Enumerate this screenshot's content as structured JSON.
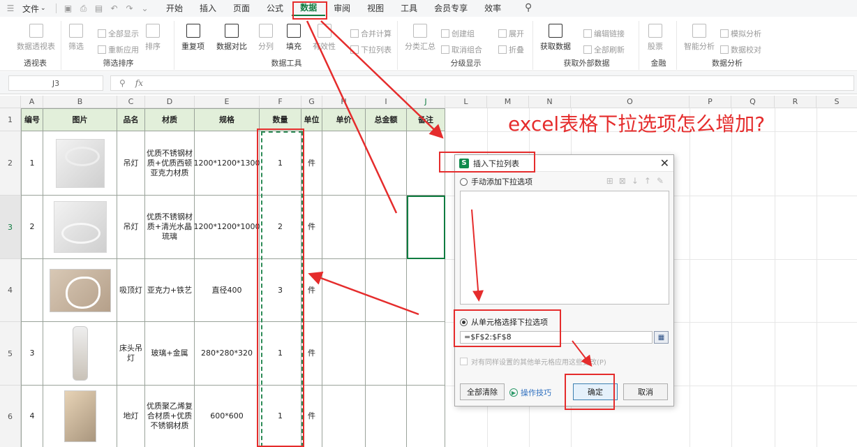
{
  "menubar": {
    "file": "文件",
    "tabs": [
      "开始",
      "插入",
      "页面",
      "公式",
      "数据",
      "审阅",
      "视图",
      "工具",
      "会员专享",
      "效率"
    ],
    "active_tab": "数据"
  },
  "ribbon": {
    "groups": {
      "pivot": "透视表",
      "filter_sort": "筛选排序",
      "data_tools": "数据工具",
      "outline": "分级显示",
      "external": "获取外部数据",
      "stocks": "金融",
      "analysis": "数据分析"
    },
    "buttons": {
      "pivot_table": "数据透视表",
      "filter": "筛选",
      "show_all": "全部显示",
      "reapply": "重新应用",
      "sort": "排序",
      "duplicates": "重复项",
      "compare": "数据对比",
      "split": "分列",
      "fill": "填充",
      "validation": "有效性",
      "merge_calc": "合并计算",
      "dropdown_list": "下拉列表",
      "subtotal": "分类汇总",
      "group": "创建组",
      "ungroup": "取消组合",
      "expand": "展开",
      "collapse": "折叠",
      "get_data": "获取数据",
      "edit_links": "编辑链接",
      "refresh_all": "全部刷新",
      "stocks": "股票",
      "smart_analysis": "智能分析",
      "simulate": "模拟分析",
      "verify": "数据校对"
    }
  },
  "formula_bar": {
    "name_box": "J3",
    "fx": "fx",
    "formula": ""
  },
  "columns": [
    "A",
    "B",
    "C",
    "D",
    "E",
    "F",
    "G",
    "H",
    "I",
    "J",
    "L",
    "M",
    "N",
    "O",
    "P",
    "Q",
    "R",
    "S"
  ],
  "rows": [
    "1",
    "2",
    "3",
    "4",
    "5",
    "6"
  ],
  "table": {
    "headers": [
      "编号",
      "图片",
      "品名",
      "材质",
      "规格",
      "数量",
      "单位",
      "单价",
      "总金额",
      "备注"
    ],
    "rows": [
      {
        "no": "1",
        "name": "吊灯",
        "material": "优质不锈钢材质+优质西顿亚克力材质",
        "spec": "1200*1200*1300",
        "qty": "1",
        "unit": "件"
      },
      {
        "no": "2",
        "name": "吊灯",
        "material": "优质不锈钢材质+清光水晶琉璃",
        "spec": "1200*1200*1000",
        "qty": "2",
        "unit": "件"
      },
      {
        "no": "",
        "name": "吸顶灯",
        "material": "亚克力+铁艺",
        "spec": "直径400",
        "qty": "3",
        "unit": "件"
      },
      {
        "no": "3",
        "name": "床头吊灯",
        "material": "玻璃+金属",
        "spec": "280*280*320",
        "qty": "1",
        "unit": "件"
      },
      {
        "no": "4",
        "name": "地灯",
        "material": "优质聚乙烯复合材质+优质不锈钢材质",
        "spec": "600*600",
        "qty": "1",
        "unit": "件"
      }
    ]
  },
  "annotation": {
    "question": "excel表格下拉选项怎么增加?"
  },
  "dialog": {
    "title": "插入下拉列表",
    "icon_letter": "S",
    "option_manual": "手动添加下拉选项",
    "option_cells": "从单元格选择下拉选项",
    "range": "=$F$2:$F$8",
    "apply_checkbox": "对有同样设置的其他单元格应用这些更改(P)",
    "clear_all": "全部清除",
    "tips": "操作技巧",
    "ok": "确定",
    "cancel": "取消",
    "selected_option": "cells"
  },
  "colors": {
    "accent": "#107c41",
    "annotation_red": "#e52c2c",
    "header_fill": "#e2efda"
  }
}
